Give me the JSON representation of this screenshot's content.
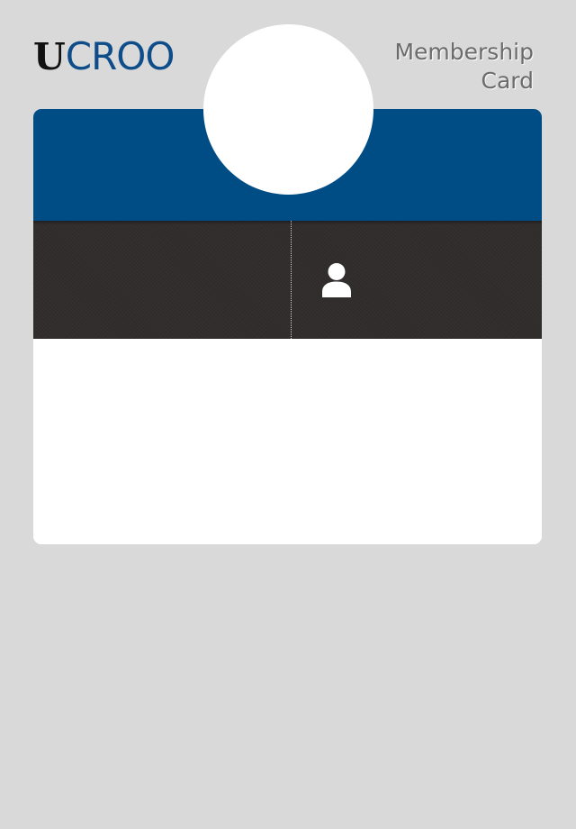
{
  "header": {
    "logo": {
      "first_letter": "U",
      "rest": "CROO"
    },
    "title_line1": "Membership",
    "title_line2": "Card"
  },
  "colors": {
    "background": "#d9d9d9",
    "brand_blue": "#004d85",
    "dark_band": "#302d2c",
    "logo_letter": "#111111",
    "logo_text": "#0e4d8a",
    "title_text": "#6b6b6b"
  },
  "card": {
    "icons": [
      "user-icon"
    ]
  }
}
